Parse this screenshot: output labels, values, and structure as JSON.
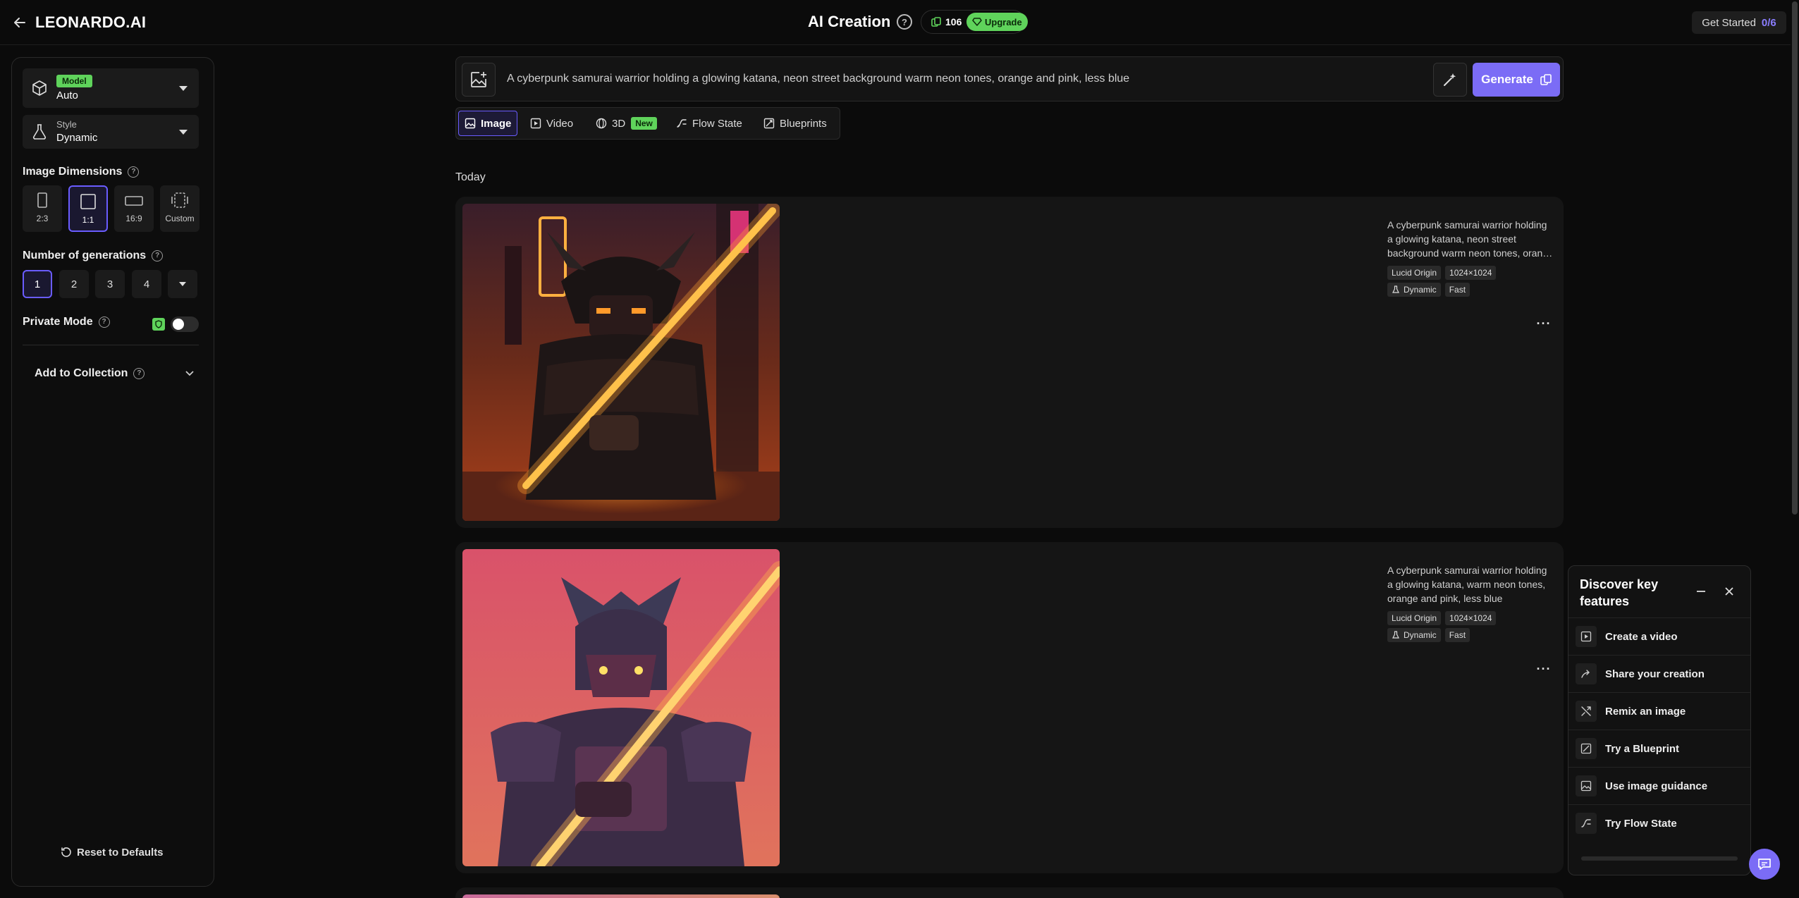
{
  "topbar": {
    "logo": "LEONARDO.AI",
    "title": "AI Creation",
    "credits": "106",
    "upgrade_label": "Upgrade",
    "get_started_label": "Get Started",
    "get_started_progress": "0/6"
  },
  "sidebar": {
    "model_badge": "Model",
    "model_value": "Auto",
    "style_label": "Style",
    "style_value": "Dynamic",
    "dimensions_label": "Image Dimensions",
    "dimensions": [
      "2:3",
      "1:1",
      "16:9",
      "Custom"
    ],
    "dimensions_selected": "1:1",
    "generations_label": "Number of generations",
    "generations": [
      "1",
      "2",
      "3",
      "4"
    ],
    "generations_selected": "1",
    "private_mode_label": "Private Mode",
    "private_mode_on": false,
    "collection_label": "Add to Collection",
    "reset_label": "Reset to Defaults"
  },
  "prompt": {
    "text": "A cyberpunk samurai warrior holding a glowing katana, neon street background warm neon tones, orange and pink, less blue",
    "generate_label": "Generate"
  },
  "tabs": [
    {
      "label": "Image",
      "icon": "image-icon"
    },
    {
      "label": "Video",
      "icon": "video-icon"
    },
    {
      "label": "3D",
      "icon": "cube-icon",
      "badge": "New"
    },
    {
      "label": "Flow State",
      "icon": "flow-icon"
    },
    {
      "label": "Blueprints",
      "icon": "blueprint-icon"
    }
  ],
  "feed": {
    "section_label": "Today",
    "generations": [
      {
        "caption": "A cyberpunk samurai warrior holding a glowing katana, neon street background warm neon tones, orange and pink, less blue",
        "model": "Lucid Origin",
        "size": "1024×1024",
        "style": "Dynamic",
        "speed": "Fast"
      },
      {
        "caption": "A cyberpunk samurai warrior holding a glowing katana, warm neon tones, orange and pink, less blue",
        "model": "Lucid Origin",
        "size": "1024×1024",
        "style": "Dynamic",
        "speed": "Fast"
      }
    ]
  },
  "discover": {
    "title": "Discover key features",
    "items": [
      {
        "label": "Create a video",
        "icon": "play-icon"
      },
      {
        "label": "Share your creation",
        "icon": "share-icon"
      },
      {
        "label": "Remix an image",
        "icon": "remix-icon"
      },
      {
        "label": "Try a Blueprint",
        "icon": "blueprint-icon"
      },
      {
        "label": "Use image guidance",
        "icon": "image-guidance-icon"
      },
      {
        "label": "Try Flow State",
        "icon": "flow-icon"
      }
    ]
  },
  "colors": {
    "accent": "#7b6cf6",
    "green": "#5fd35b",
    "background": "#0b0b0b"
  }
}
